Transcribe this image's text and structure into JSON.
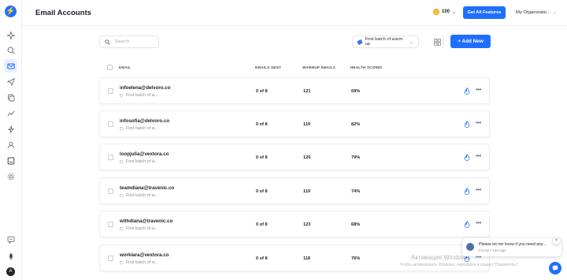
{
  "app": {
    "logo_glyph": "⚡",
    "accent": "#1f6fff"
  },
  "sidebar": {
    "items": [
      {
        "icon": "sparkle-icon"
      },
      {
        "icon": "search-icon"
      },
      {
        "icon": "mail-icon",
        "active": true
      },
      {
        "icon": "send-icon"
      },
      {
        "icon": "inbox-stack-icon"
      },
      {
        "icon": "analytics-icon"
      },
      {
        "icon": "bolt-icon"
      },
      {
        "icon": "contacts-icon"
      },
      {
        "icon": "template-icon"
      },
      {
        "icon": "settings-icon"
      },
      {
        "icon": "feedback-icon"
      },
      {
        "icon": "rocket-icon"
      }
    ],
    "user_initial": "A"
  },
  "header": {
    "title": "Email Accounts",
    "credits": "100",
    "get_features_label": "Get All Features",
    "org_label": "My Organizatio..."
  },
  "toolbar": {
    "search_placeholder": "Search",
    "campaign_filter": "First batch of warm up",
    "add_new_label": "+ Add New"
  },
  "table": {
    "columns": {
      "email": "EMAIL",
      "sent": "EMAILS SENT",
      "warmup": "WARMUP EMAILS",
      "health": "HEALTH SCORE"
    },
    "rows": [
      {
        "email": "infoelena@delvoro.co",
        "tag": "First batch of w...",
        "sent": "0 of 8",
        "warmup": "121",
        "health": "69%"
      },
      {
        "email": "infosofia@delvoro.co",
        "tag": "First batch of w...",
        "sent": "0 of 8",
        "warmup": "119",
        "health": "82%"
      },
      {
        "email": "loopjulia@vextora.co",
        "tag": "First batch of w...",
        "sent": "0 of 8",
        "warmup": "120",
        "health": "79%"
      },
      {
        "email": "teamdiana@travenic.co",
        "tag": "First batch of w...",
        "sent": "0 of 8",
        "warmup": "119",
        "health": "74%"
      },
      {
        "email": "withdiana@travenic.co",
        "tag": "First batch of w...",
        "sent": "0 of 8",
        "warmup": "123",
        "health": "68%"
      },
      {
        "email": "workiara@vextora.co",
        "tag": "First batch of w...",
        "sent": "0 of 8",
        "warmup": "118",
        "health": "76%"
      }
    ]
  },
  "chat": {
    "message": "Please let me know if you need any...",
    "meta": "Fin bot • 14m ago"
  },
  "watermark": {
    "title": "Активация Windows",
    "subtitle": "Чтобы активировать Windows, перейдите в раздел \"Параметры\"."
  }
}
